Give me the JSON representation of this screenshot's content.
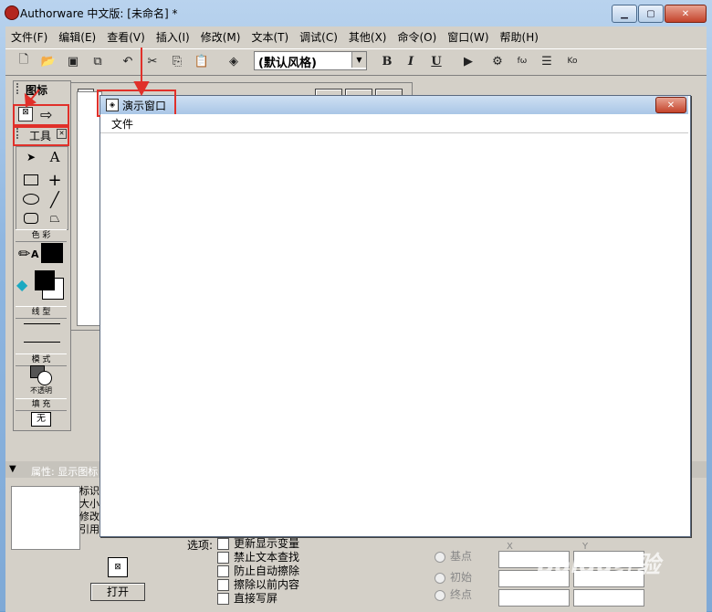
{
  "window": {
    "title": "Authorware 中文版: [未命名] *",
    "caption_buttons": [
      "minimize",
      "maximize",
      "close"
    ]
  },
  "menubar": {
    "items": [
      "文件(F)",
      "编辑(E)",
      "查看(V)",
      "插入(I)",
      "修改(M)",
      "文本(T)",
      "调试(C)",
      "其他(X)",
      "命令(O)",
      "窗口(W)",
      "帮助(H)"
    ]
  },
  "toolbar": {
    "style_combo": "(默认风格)",
    "bold": "B",
    "italic": "I",
    "underline": "U"
  },
  "icon_palette": {
    "title": "图标",
    "tools_title": "工具",
    "text_tool": "A",
    "color_label": "色 彩",
    "line_label": "线 型",
    "mode_label": "模 式",
    "mode_value": "不透明",
    "fill_label": "填 充",
    "fill_value": "无"
  },
  "presentation_window": {
    "title": "演示窗口",
    "menu": "文件"
  },
  "properties": {
    "header": "属性: 显示图标",
    "labels": [
      "标识",
      "大小",
      "修改",
      "引用"
    ],
    "open_button": "打开",
    "options_label": "选项:",
    "options": [
      "更新显示变量",
      "禁止文本查找",
      "防止自动擦除",
      "擦除以前内容",
      "直接写屏"
    ],
    "radios": [
      "基点",
      "初始",
      "终点"
    ],
    "x_label": "X",
    "y_label": "Y"
  },
  "watermark": "Baidu经验"
}
